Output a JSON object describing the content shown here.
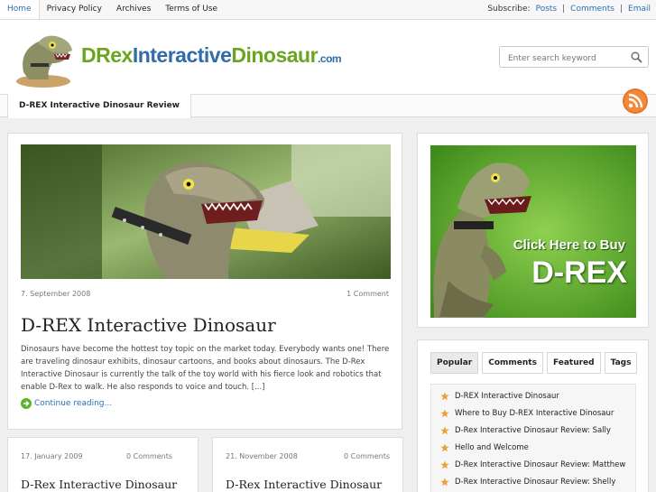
{
  "topbar": {
    "links": [
      "Home",
      "Privacy Policy",
      "Archives",
      "Terms of Use"
    ],
    "subscribe_label": "Subscribe:",
    "posts": "Posts",
    "comments": "Comments",
    "email": "Email",
    "separator": "|"
  },
  "brand": {
    "part1": "DRex",
    "part2": "Interactive",
    "part3": "Dinosaur",
    "tld": ".com"
  },
  "search": {
    "placeholder": "Enter search keyword",
    "icon": "search-icon"
  },
  "nav": {
    "active_tab": "D-REX Interactive Dinosaur Review",
    "rss_icon": "rss-icon"
  },
  "main_post": {
    "date": "7. September 2008",
    "comments": "1 Comment",
    "title": "D-REX Interactive Dinosaur",
    "excerpt": "Dinosaurs have become the hottest toy topic on the market today.  Everybody wants one!  There are traveling dinosaur exhibits, dinosaur cartoons, and books about dinosaurs.  The D-Rex Interactive Dinosaur is currently the talk of the toy world with his fierce look and robotics that enable D-Rex to walk.  He also responds to voice and touch.  [...]",
    "read_more": "Continue reading..."
  },
  "small_posts": [
    {
      "date": "17. January 2009",
      "comments": "0 Comments",
      "title": "D-Rex Interactive Dinosaur"
    },
    {
      "date": "21. November 2008",
      "comments": "0 Comments",
      "title": "D-Rex Interactive Dinosaur"
    }
  ],
  "ad": {
    "line1": "Click Here to Buy",
    "line2": "D-REX"
  },
  "sidebar_tabs": [
    "Popular",
    "Comments",
    "Featured",
    "Tags"
  ],
  "popular": [
    "D-REX Interactive Dinosaur",
    "Where to Buy D-REX Interactive Dinosaur",
    "D-Rex Interactive Dinosaur Review: Sally",
    "Hello and Welcome",
    "D-Rex Interactive Dinosaur Review: Matthew",
    "D-Rex Interactive Dinosaur Review: Shelly"
  ],
  "colors": {
    "link": "#2a6fb5",
    "brand_green": "#6aa51f",
    "brand_blue": "#2f6ca8",
    "ad_green": "#5cb32c",
    "star": "#e8a23a"
  }
}
